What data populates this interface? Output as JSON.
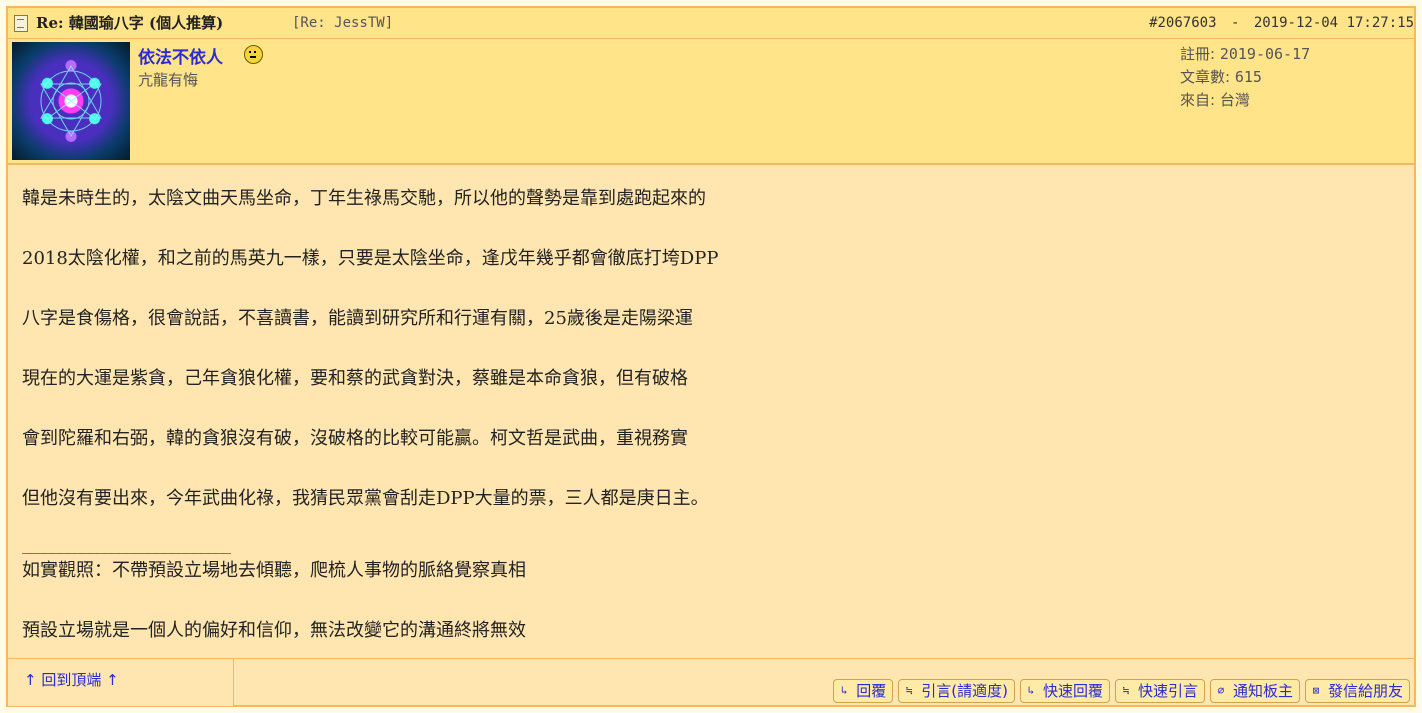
{
  "post": {
    "title": "Re: 韓國瑜八字 (個人推算)",
    "reply_to": "[Re: JessTW]",
    "post_id": "#2067603",
    "separator": "-",
    "date": "2019-12-04",
    "time": "17:27:15"
  },
  "author": {
    "name": "依法不依人",
    "title": "亢龍有悔",
    "stats": [
      {
        "label": "註冊:",
        "value": "2019-06-17"
      },
      {
        "label": "文章數:",
        "value": "615"
      },
      {
        "label": "來自:",
        "value": "台灣"
      }
    ]
  },
  "body": {
    "paragraphs": [
      "韓是未時生的，太陰文曲天馬坐命，丁年生祿馬交馳，所以他的聲勢是靠到處跑起來的",
      "2018太陰化權，和之前的馬英九一樣，只要是太陰坐命，逢戊年幾乎都會徹底打垮DPP",
      "八字是食傷格，很會說話，不喜讀書，能讀到研究所和行運有關，25歲後是走陽梁運",
      "現在的大運是紫貪，己年貪狼化權，要和蔡的武貪對決，蔡雖是本命貪狼，但有破格",
      "會到陀羅和右弼，韓的貪狼沒有破，沒破格的比較可能贏。柯文哲是武曲，重視務實",
      "但他沒有要出來，今年武曲化祿，我猜民眾黨會刮走DPP大量的票，三人都是庚日主。"
    ],
    "signature_separator": "____________________________",
    "signature": [
      "如實觀照：不帶預設立場地去傾聽，爬梳人事物的脈絡覺察真相",
      "預設立場就是一個人的偏好和信仰，無法改變它的溝通終將無效"
    ]
  },
  "footer": {
    "back_to_top": "↑ 回到頂端 ↑",
    "actions": [
      {
        "icon": "reply-icon",
        "glyph": "↳",
        "label": "回覆"
      },
      {
        "icon": "quote-icon",
        "glyph": "≒",
        "label": "引言(請適度)"
      },
      {
        "icon": "quick-reply-icon",
        "glyph": "↳",
        "label": "快速回覆"
      },
      {
        "icon": "quick-quote-icon",
        "glyph": "≒",
        "label": "快速引言"
      },
      {
        "icon": "notify-icon",
        "glyph": "⌀",
        "label": "通知板主"
      },
      {
        "icon": "mail-icon",
        "glyph": "⊠",
        "label": "發信給朋友"
      }
    ]
  }
}
